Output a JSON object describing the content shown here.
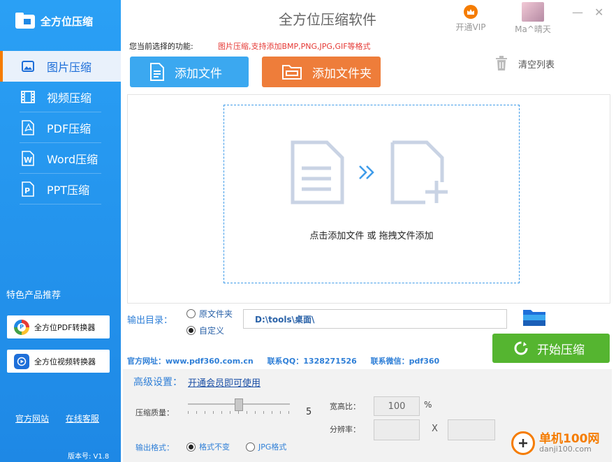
{
  "sidebar": {
    "logo_text": "全方位压缩",
    "items": [
      {
        "label": "图片压缩",
        "icon": "image-icon"
      },
      {
        "label": "视频压缩",
        "icon": "film-icon"
      },
      {
        "label": "PDF压缩",
        "icon": "pdf-icon"
      },
      {
        "label": "Word压缩",
        "icon": "word-icon"
      },
      {
        "label": "PPT压缩",
        "icon": "ppt-icon"
      }
    ],
    "feature_title": "特色产品推荐",
    "promos": [
      {
        "label": "全方位PDF转换器",
        "icon": "pdf-converter-icon"
      },
      {
        "label": "全方位视频转换器",
        "icon": "video-converter-icon"
      }
    ],
    "links": {
      "website": "官方网站",
      "support": "在线客服"
    },
    "version": "版本号:   V1.8"
  },
  "titlebar": {
    "title": "全方位压缩软件",
    "vip_label": "开通VIP",
    "username": "Ma^晴天"
  },
  "function": {
    "label": "您当前选择的功能:",
    "value": "图片压缩,支持添加BMP,PNG,JPG,GIF等格式"
  },
  "toolbar": {
    "add_file": "添加文件",
    "add_folder": "添加文件夹",
    "clear_list": "清空列表"
  },
  "dropzone": {
    "hint": "点击添加文件 或 拖拽文件添加"
  },
  "output": {
    "label": "输出目录：",
    "option_original": "原文件夹",
    "option_custom": "自定义",
    "selected": "custom",
    "path": "D:\\tools\\桌面\\",
    "start_button": "开始压缩"
  },
  "contacts": {
    "website": "官方网址：www.pdf360.com.cn",
    "qq": "联系QQ：1328271526",
    "wechat": "联系微信：pdf360"
  },
  "advanced": {
    "title": "高级设置：",
    "link": "开通会员即可使用",
    "quality_label": "压缩质量：",
    "quality_value": "5",
    "aspect_label": "宽高比：",
    "aspect_value": "100",
    "aspect_unit": "%",
    "resolution_label": "分辨率：",
    "resolution_sep": "X",
    "format_label": "输出格式：",
    "format_keep": "格式不变",
    "format_jpg": "JPG格式",
    "format_selected": "keep"
  },
  "watermark": {
    "line1": "单机100网",
    "line2": "danji100.com"
  },
  "colors": {
    "sidebar": "#2196f3",
    "add_file_btn": "#3ba8f0",
    "add_folder_btn": "#ee7d3a",
    "start_btn": "#55b530",
    "accent_blue": "#2f7fd7",
    "warning_red": "#e53935"
  }
}
